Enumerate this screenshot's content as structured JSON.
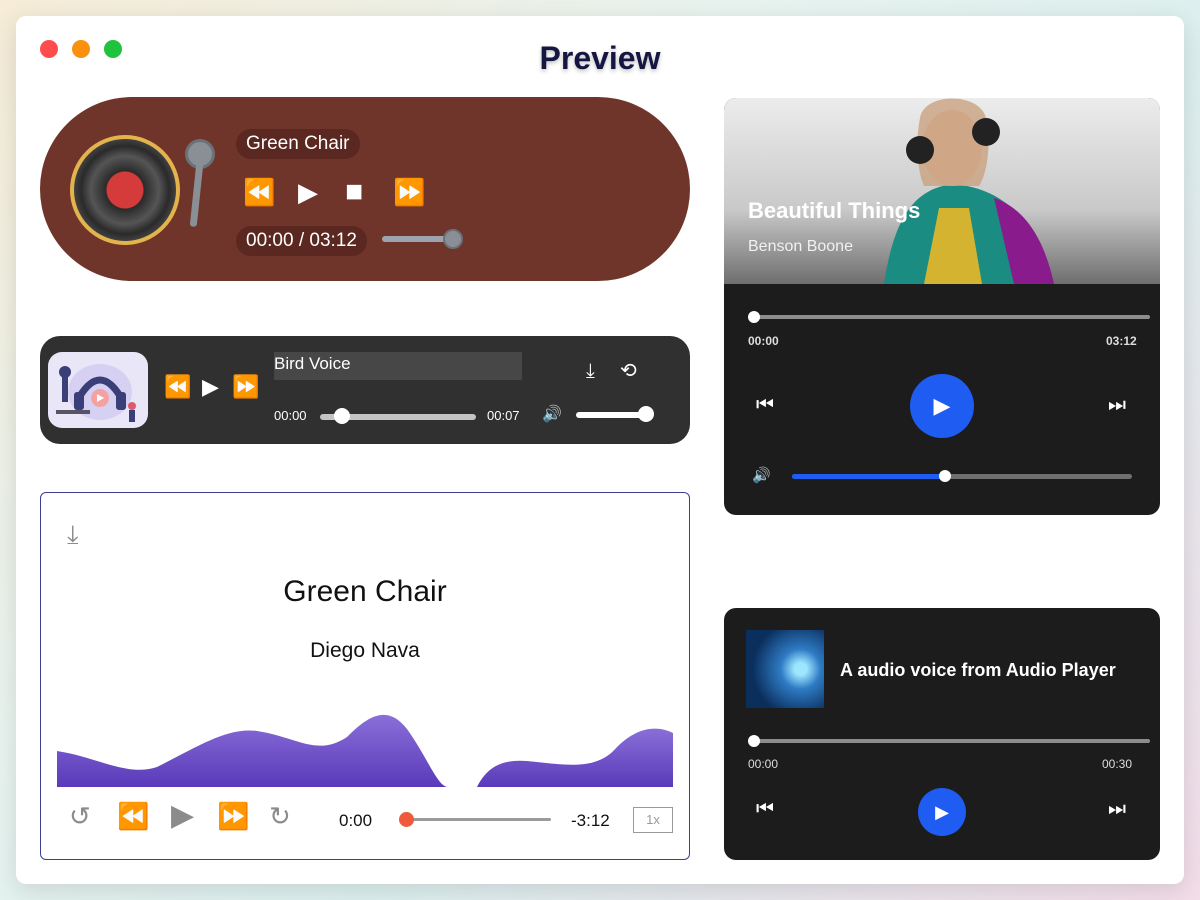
{
  "window": {
    "title": "Preview"
  },
  "player1": {
    "song": "Green Chair",
    "time": "00:00 / 03:12",
    "controls": {
      "rewind": "⏪",
      "play": "▶",
      "stop": "■",
      "forward": "⏩"
    },
    "volume": 0.85
  },
  "player2": {
    "title": "Bird Voice",
    "current_time": "00:00",
    "duration": "00:07",
    "controls": {
      "rewind": "⏪",
      "play": "▶",
      "forward": "⏩",
      "download": "⤓",
      "repeat": "⟲",
      "volume": "🔊"
    },
    "progress": 0.1,
    "volume": 1.0
  },
  "player3": {
    "title": "Green Chair",
    "artist": "Diego Nava",
    "current_time": "0:00",
    "remaining_time": "-3:12",
    "rate": "1x",
    "controls": {
      "replay": "↺",
      "rewind": "⏪",
      "play": "▶",
      "forward": "⏩",
      "redo": "↻",
      "download": "⤓"
    }
  },
  "player4": {
    "song": "Beautiful Things",
    "artist": "Benson Boone",
    "current_time": "00:00",
    "duration": "03:12",
    "controls": {
      "prev": "⏮",
      "play": "▶",
      "next": "⏭",
      "volume": "🔊"
    },
    "volume": 0.45
  },
  "player5": {
    "title": "A audio voice from Audio Player",
    "current_time": "00:00",
    "duration": "00:30",
    "controls": {
      "prev": "⏮",
      "play": "▶",
      "next": "⏭"
    }
  },
  "colors": {
    "brand_blue": "#1f5cf2",
    "vinyl_brown": "#6f342a",
    "wave_purple": "#6d4fcf",
    "accent_orange": "#f05a3a"
  }
}
